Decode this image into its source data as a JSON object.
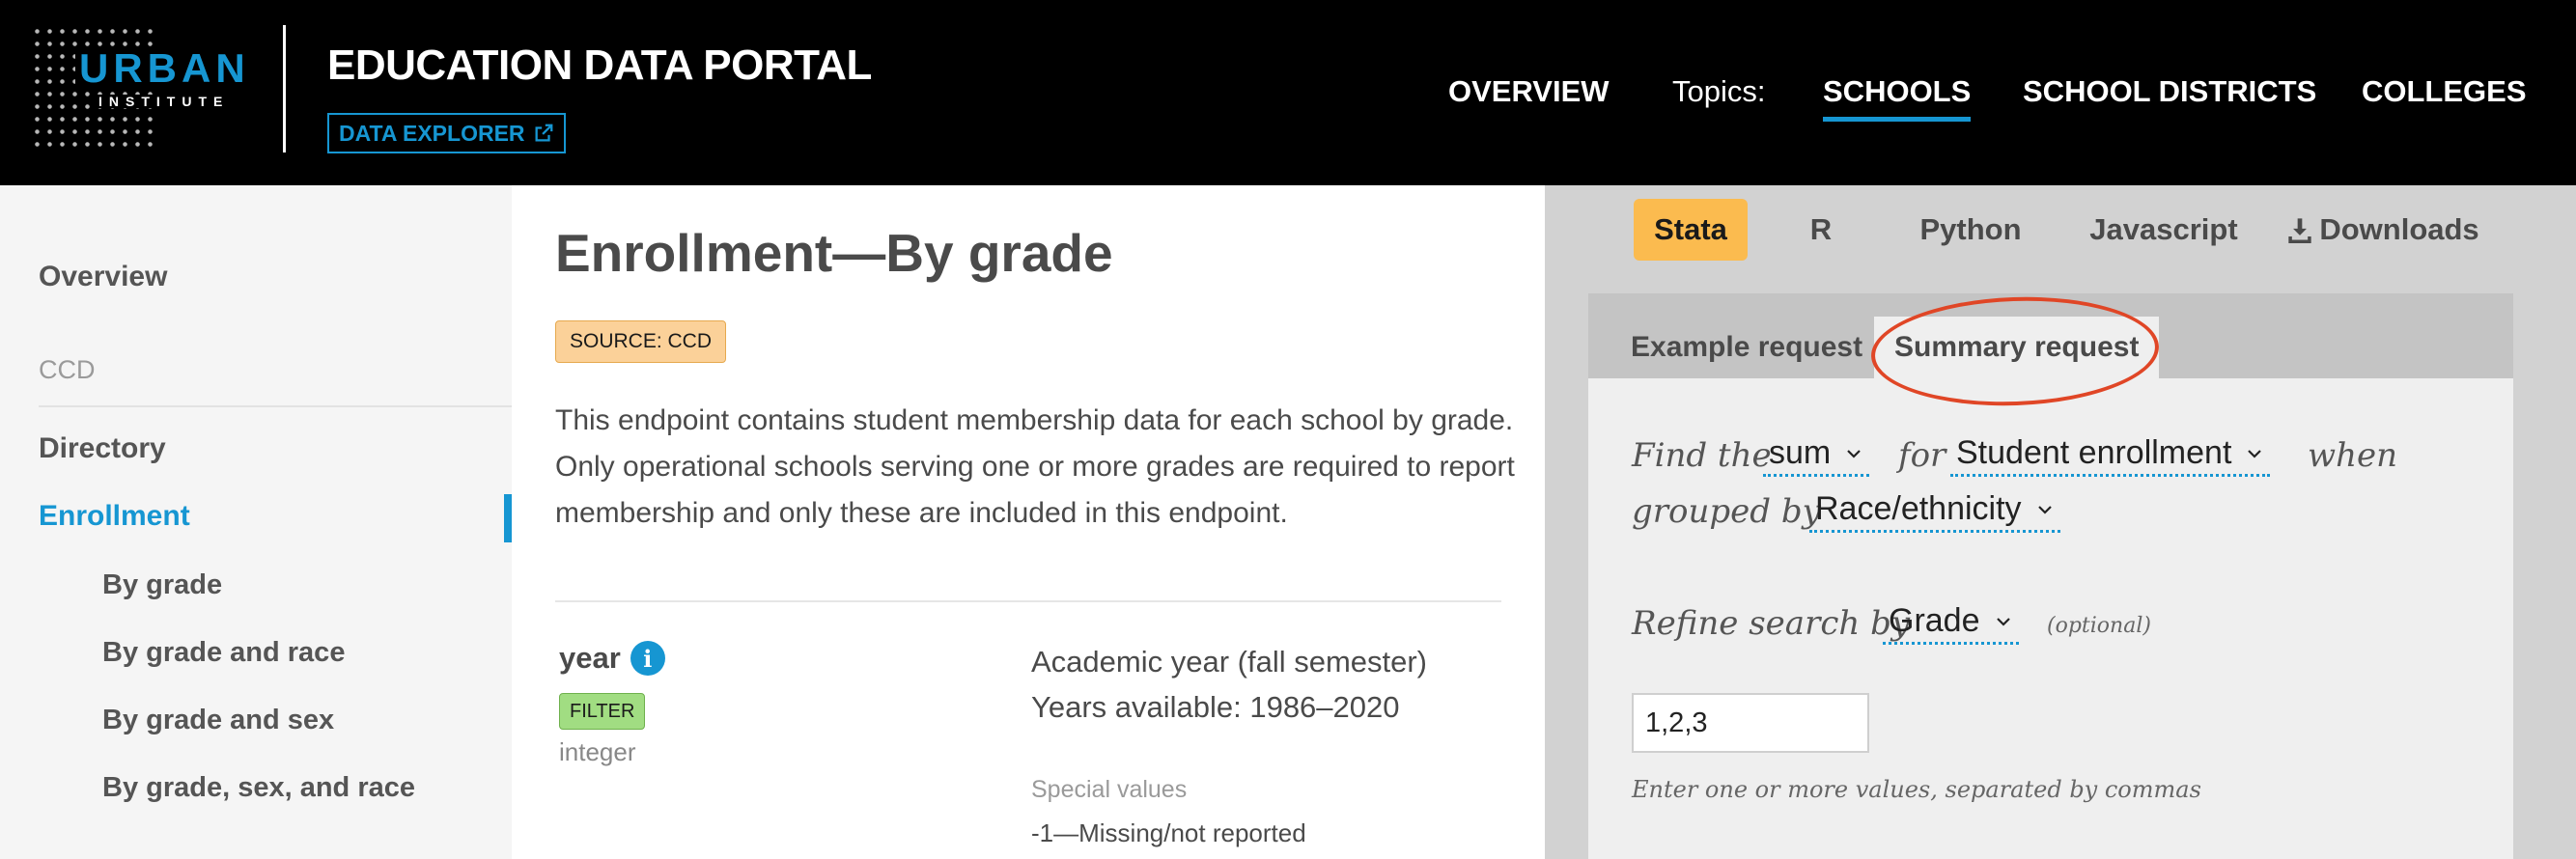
{
  "header": {
    "logo_top": "URBAN",
    "logo_bottom": "INSTITUTE",
    "title": "EDUCATION DATA PORTAL",
    "explorer_label": "DATA EXPLORER",
    "nav": {
      "overview": "OVERVIEW",
      "topics": "Topics:",
      "schools": "SCHOOLS",
      "districts": "SCHOOL DISTRICTS",
      "colleges": "COLLEGES"
    },
    "active_nav": "SCHOOLS"
  },
  "sidebar": {
    "overview": "Overview",
    "ccd": "CCD",
    "directory": "Directory",
    "enrollment": "Enrollment",
    "subitems": [
      "By grade",
      "By grade and race",
      "By grade and sex",
      "By grade, sex, and race"
    ],
    "active": "Enrollment"
  },
  "main": {
    "title": "Enrollment—By grade",
    "source_badge": "SOURCE: CCD",
    "description": "This endpoint contains student membership data for each school by grade. Only operational schools serving one or more grades are required to report membership and only these are included in this endpoint.",
    "field": {
      "name": "year",
      "filter_badge": "FILTER",
      "type": "integer",
      "desc_line1": "Academic year (fall semester)",
      "desc_line2": "Years available: 1986–2020",
      "special_heading": "Special values",
      "special_value": "-1—Missing/not reported"
    }
  },
  "right_panel": {
    "lang_tabs": [
      "Stata",
      "R",
      "Python",
      "Javascript",
      "Downloads"
    ],
    "active_lang": "Stata",
    "request_tabs": [
      "Example request",
      "Summary request"
    ],
    "active_request": "Summary request",
    "form": {
      "find_the": "Find the",
      "stat_value": "sum",
      "for": "for",
      "variable_value": "Student enrollment",
      "when": "when",
      "grouped_by": "grouped by",
      "group_value": "Race/ethnicity",
      "refine": "Refine search by",
      "refine_value": "Grade",
      "optional": "(optional)",
      "input_value": "1,2,3",
      "help": "Enter one or more values, separated by commas"
    }
  },
  "colors": {
    "accent_blue": "#1696d2",
    "stata_yellow": "#fbbb4f",
    "highlight_red": "#e04626"
  }
}
